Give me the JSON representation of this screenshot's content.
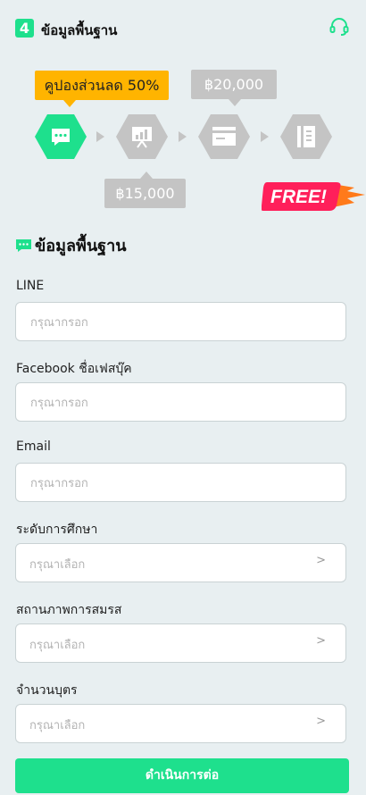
{
  "header": {
    "step_number": "4",
    "title": "ข้อมูลพื้นฐาน",
    "support_icon": "headset-icon"
  },
  "progress": {
    "coupon_label": "คูปองส่วนลด 50%",
    "price_top": "฿20,000",
    "price_bottom": "฿15,000",
    "free_label": "FREE!",
    "steps": [
      {
        "icon": "chat-icon",
        "active": true
      },
      {
        "icon": "presentation-icon",
        "active": false
      },
      {
        "icon": "card-icon",
        "active": false
      },
      {
        "icon": "notebook-icon",
        "active": false
      }
    ],
    "active_color": "#1ee08d",
    "inactive_color": "#c4c4c4"
  },
  "section": {
    "title": "ข้อมูลพื้นฐาน"
  },
  "form": {
    "line": {
      "label": "LINE",
      "placeholder": "กรุณากรอก"
    },
    "facebook": {
      "label": "Facebook ชื่อเฟสบุ๊ค",
      "placeholder": "กรุณากรอก"
    },
    "email": {
      "label": "Email",
      "placeholder": "กรุณากรอก"
    },
    "education": {
      "label": "ระดับการศึกษา",
      "placeholder": "กรุณาเลือก",
      "chevron": ">"
    },
    "marital": {
      "label": "สถานภาพการสมรส",
      "placeholder": "กรุณาเลือก",
      "chevron": ">"
    },
    "children": {
      "label": "จำนวนบุตร",
      "placeholder": "กรุณาเลือก",
      "chevron": ">"
    }
  },
  "submit_label": "ดำเนินการต่อ",
  "accent_color": "#1ee08d"
}
